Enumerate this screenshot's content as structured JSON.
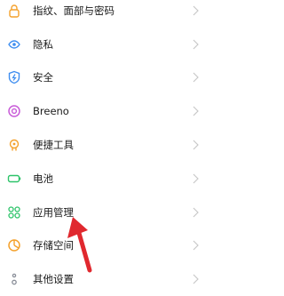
{
  "colors": {
    "text": "#1a1a1a",
    "chevron": "#c8c8c8",
    "annotation_arrow": "#e0282e"
  },
  "settings": {
    "items": [
      {
        "label": "指纹、面部与密码",
        "icon": "fingerprint-lock-icon",
        "color": "#f4a12c"
      },
      {
        "label": "隐私",
        "icon": "privacy-eye-icon",
        "color": "#3f8ef0"
      },
      {
        "label": "安全",
        "icon": "shield-icon",
        "color": "#3f8ef0"
      },
      {
        "label": "Breeno",
        "icon": "breeno-ring-icon",
        "color": "#c85bd8"
      },
      {
        "label": "便捷工具",
        "icon": "hand-tool-icon",
        "color": "#f4a12c"
      },
      {
        "label": "电池",
        "icon": "battery-icon",
        "color": "#2ec46a"
      },
      {
        "label": "应用管理",
        "icon": "app-grid-icon",
        "color": "#2ec46a"
      },
      {
        "label": "存储空间",
        "icon": "storage-pie-icon",
        "color": "#f4a12c"
      },
      {
        "label": "其他设置",
        "icon": "more-settings-icon",
        "color": "#8a8f99"
      }
    ]
  }
}
